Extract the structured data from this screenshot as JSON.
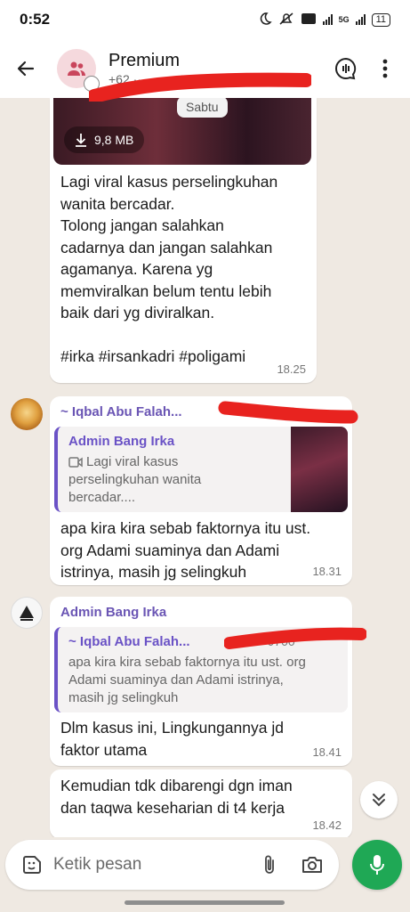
{
  "status_bar": {
    "time": "0:52",
    "network_label": "5G",
    "battery": "11"
  },
  "header": {
    "title": "Premium",
    "subtitle": "+62 ··· ··· ··· 77"
  },
  "messages": [
    {
      "media_size": "9,8 MB",
      "date_chip": "Sabtu",
      "text": "Lagi viral kasus perselingkuhan\nwanita bercadar.\nTolong jangan salahkan\ncadarnya dan jangan salahkan\nagamanya. Karena yg\nmemviralkan belum tentu lebih\nbaik dari yg diviralkan.\n\n#irka #irsankadri #poligami",
      "time": "18.25"
    },
    {
      "sender": "~ Iqbal Abu Falah...",
      "sender_phone": "+62 ··· 0700",
      "quote_name": "Admin Bang Irka",
      "quote_text": "Lagi viral kasus\nperselingkuhan wanita\nbercadar....",
      "text": "apa kira kira sebab faktornya itu ust.\norg Adami suaminya dan Adami\nistrinya, masih jg selingkuh",
      "time": "18.31"
    },
    {
      "sender": "Admin Bang Irka",
      "quote_name": "~ Iqbal Abu Falah...",
      "quote_phone": "+62 ··· 0700",
      "quote_text": "apa kira kira sebab faktornya itu ust. org\nAdami suaminya dan Adami istrinya,\nmasih jg selingkuh",
      "text": "Dlm kasus ini, Lingkungannya jd\nfaktor utama",
      "time": "18.41"
    },
    {
      "text": "Kemudian tdk dibarengi dgn iman\ndan taqwa keseharian di t4 kerja",
      "time": "18.42"
    }
  ],
  "composer": {
    "placeholder": "Ketik pesan"
  },
  "colors": {
    "accent": "#1fa855",
    "quote_bar": "#6a52c6",
    "redaction": "#e8231f"
  }
}
